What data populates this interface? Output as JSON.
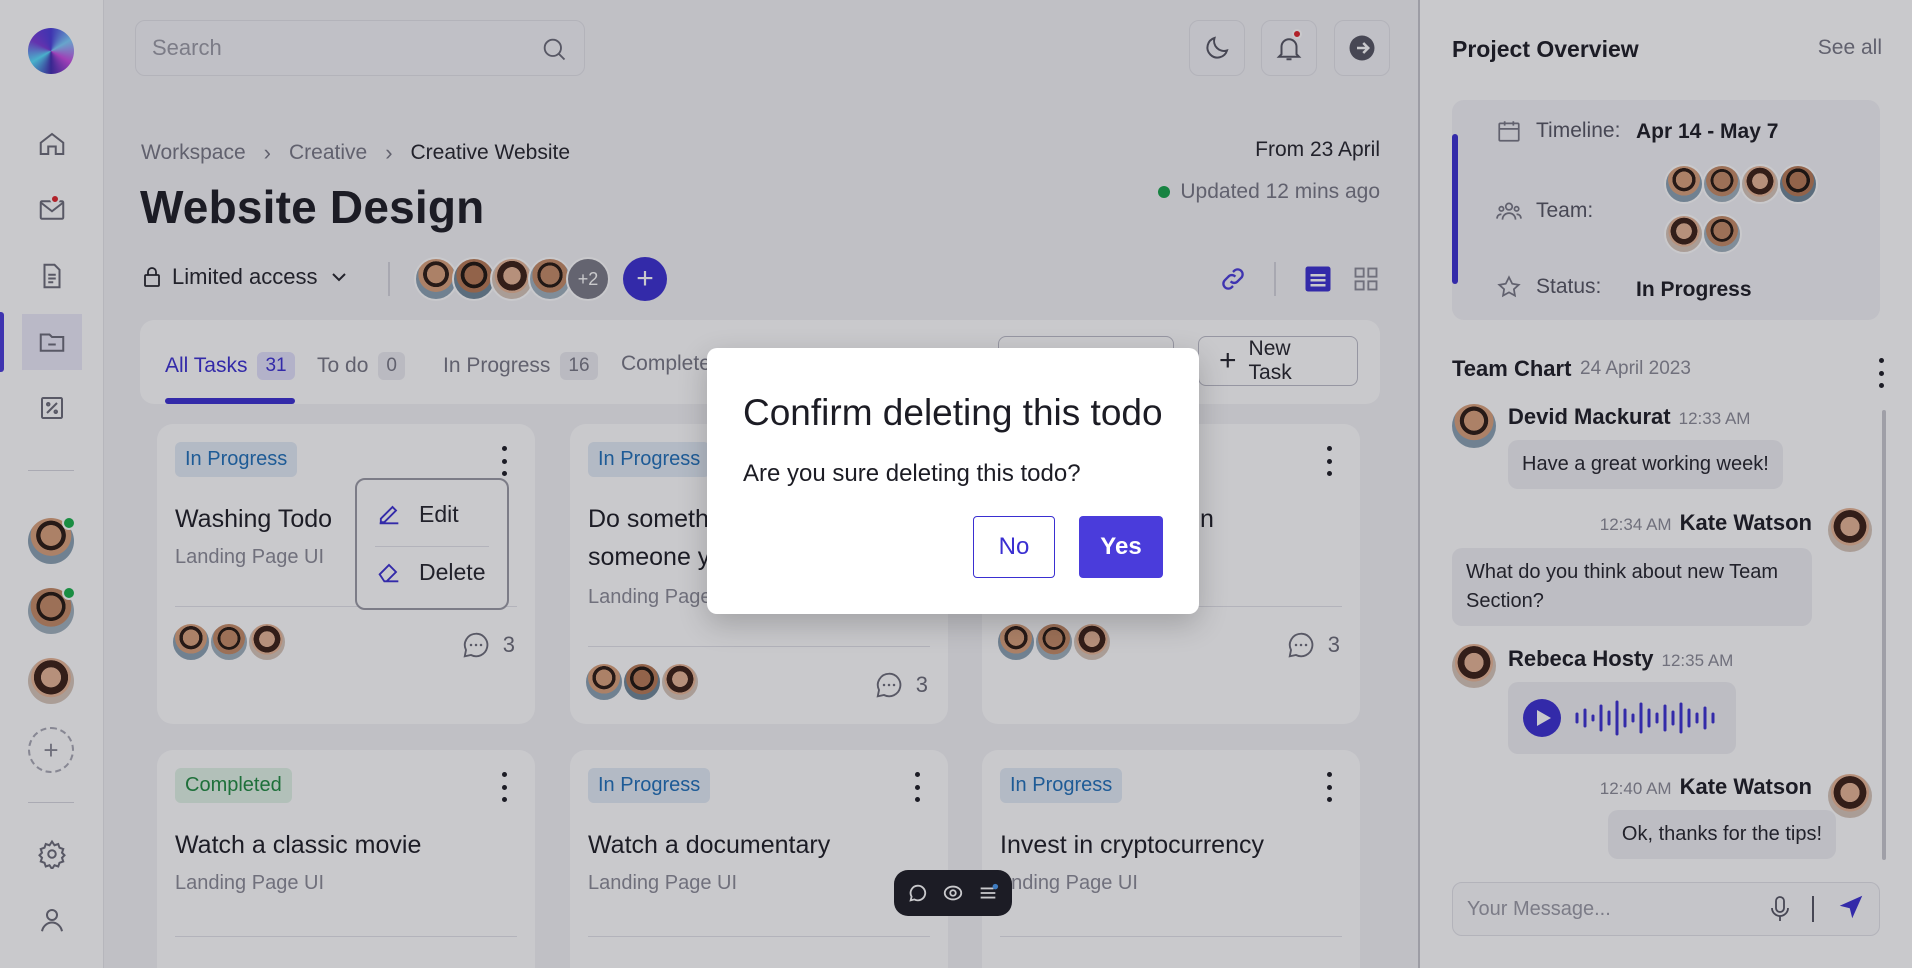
{
  "search": {
    "placeholder": "Search"
  },
  "breadcrumb": [
    "Workspace",
    "Creative",
    "Creative Website"
  ],
  "header": {
    "from": "From 23 April",
    "updated": "Updated 12 mins ago",
    "title": "Website Design",
    "access": "Limited access",
    "members_more": "+2"
  },
  "tabs": [
    {
      "label": "All Tasks",
      "count": "31"
    },
    {
      "label": "To do",
      "count": "0"
    },
    {
      "label": "In Progress",
      "count": "16"
    },
    {
      "label": "Complete"
    }
  ],
  "new_task_label": "New Task",
  "cards": [
    {
      "status": "In Progress",
      "title": "Washing Todo",
      "subtitle": "Landing Page UI",
      "comments": "3"
    },
    {
      "status": "In Progress",
      "title": "Do someth",
      "title2": "someone y",
      "subtitle": "Landing Page",
      "comments": "3"
    },
    {
      "title": "n",
      "comments": "3"
    },
    {
      "status": "Completed",
      "title": "Watch a classic movie",
      "subtitle": "Landing Page UI"
    },
    {
      "status": "In Progress",
      "title": "Watch a documentary",
      "subtitle": "Landing Page UI"
    },
    {
      "status": "In Progress",
      "title": "Invest in cryptocurrency",
      "subtitle": "anding Page UI"
    }
  ],
  "context_menu": {
    "edit": "Edit",
    "delete": "Delete"
  },
  "overview": {
    "title": "Project Overview",
    "see_all": "See all",
    "timeline_label": "Timeline:",
    "timeline_value": "Apr 14 - May 7",
    "team_label": "Team:",
    "status_label": "Status:",
    "status_value": "In Progress"
  },
  "chat": {
    "title": "Team Chart",
    "date": "24 April 2023",
    "messages": [
      {
        "name": "Devid Mackurat",
        "time": "12:33 AM",
        "text": "Have a great working week!"
      },
      {
        "name": "Kate Watson",
        "time": "12:34 AM",
        "text": "What do you think about new Team Section?"
      },
      {
        "name": "Rebeca Hosty",
        "time": "12:35 AM"
      },
      {
        "name": "Kate Watson",
        "time": "12:40 AM",
        "text": "Ok, thanks for the tips!"
      }
    ],
    "input_placeholder": "Your Message..."
  },
  "modal": {
    "title": "Confirm deleting this todo",
    "text": "Are you sure deleting this todo?",
    "no": "No",
    "yes": "Yes"
  },
  "colors": {
    "accent": "#4a3cdb",
    "in_progress": "#1f6fb8",
    "completed": "#1f8a40",
    "notification": "#e0242b",
    "online": "#18b04a"
  },
  "icons": [
    "home-icon",
    "mail-icon",
    "document-icon",
    "folder-icon",
    "percent-icon",
    "settings-icon",
    "user-icon",
    "moon-icon",
    "bell-icon",
    "logout-icon",
    "link-icon",
    "list-view-icon",
    "grid-view-icon",
    "lock-icon",
    "chevron-down-icon",
    "comment-icon",
    "edit-icon",
    "eraser-icon",
    "calendar-icon",
    "team-icon",
    "star-icon",
    "play-icon",
    "mic-icon",
    "send-icon"
  ]
}
